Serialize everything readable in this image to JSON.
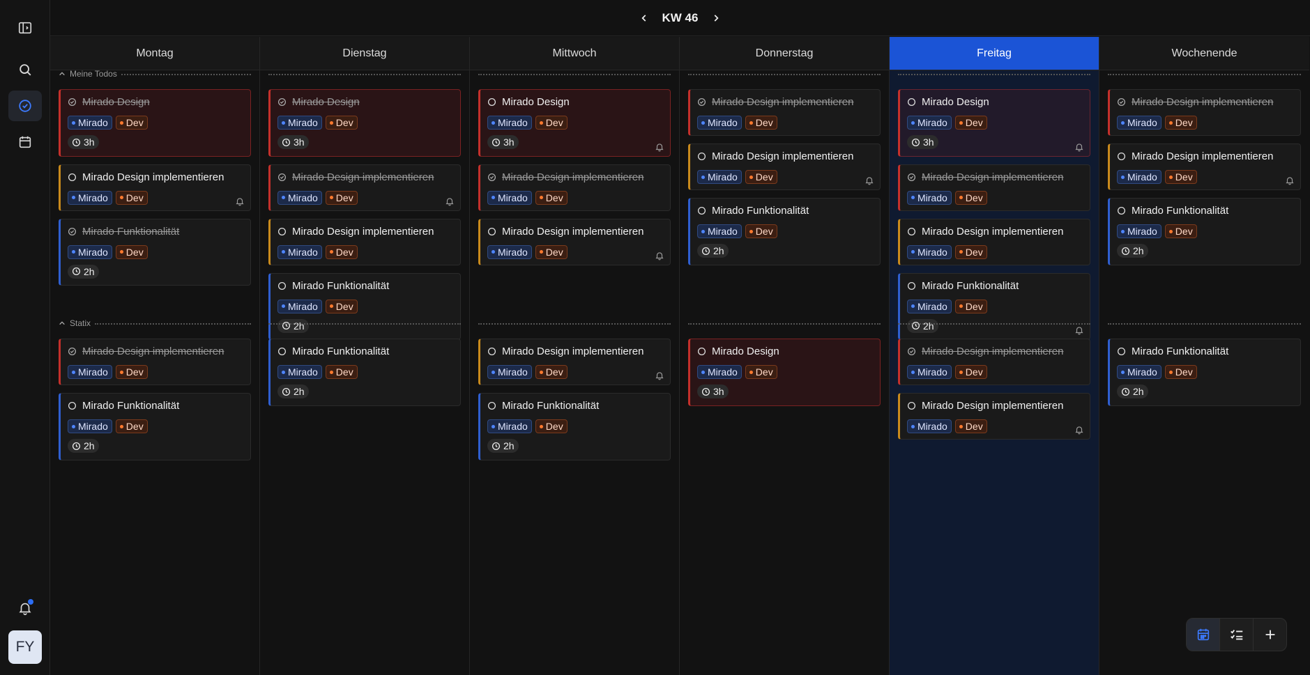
{
  "header": {
    "week_label": "KW 46"
  },
  "sidebar": {
    "avatar_initials": "FY"
  },
  "sections": [
    "Meine Todos",
    "Statix"
  ],
  "days": [
    {
      "label": "Montag",
      "today": false,
      "groups": [
        [
          {
            "title": "Mirado Design",
            "done": true,
            "style": "hl",
            "duration": "3h",
            "bell": false
          },
          {
            "title": "Mirado Design implementieren",
            "done": false,
            "style": "c-amber",
            "duration": null,
            "bell": true
          },
          {
            "title": "Mirado Funktionalität",
            "done": true,
            "style": "c-blue",
            "duration": "2h",
            "bell": false
          }
        ],
        [
          {
            "title": "Mirado Design implementieren",
            "done": true,
            "style": "c-red",
            "duration": null,
            "bell": false
          },
          {
            "title": "Mirado Funktionalität",
            "done": false,
            "style": "c-blue",
            "duration": "2h",
            "bell": false
          }
        ]
      ]
    },
    {
      "label": "Dienstag",
      "today": false,
      "groups": [
        [
          {
            "title": "Mirado Design",
            "done": true,
            "style": "hl",
            "duration": "3h",
            "bell": false
          },
          {
            "title": "Mirado Design implementieren",
            "done": true,
            "style": "c-red",
            "duration": null,
            "bell": true
          },
          {
            "title": "Mirado Design implementieren",
            "done": false,
            "style": "c-amber",
            "duration": null,
            "bell": false
          },
          {
            "title": "Mirado Funktionalität",
            "done": false,
            "style": "c-blue",
            "duration": "2h",
            "bell": false
          }
        ],
        [
          {
            "title": "Mirado Funktionalität",
            "done": false,
            "style": "c-blue",
            "duration": "2h",
            "bell": false
          }
        ]
      ]
    },
    {
      "label": "Mittwoch",
      "today": false,
      "groups": [
        [
          {
            "title": "Mirado Design",
            "done": false,
            "style": "hl",
            "duration": "3h",
            "bell": true
          },
          {
            "title": "Mirado Design implementieren",
            "done": true,
            "style": "c-red",
            "duration": null,
            "bell": false
          },
          {
            "title": "Mirado Design implementieren",
            "done": false,
            "style": "c-amber",
            "duration": null,
            "bell": true
          }
        ],
        [
          {
            "title": "Mirado Design implementieren",
            "done": false,
            "style": "c-amber",
            "duration": null,
            "bell": true
          },
          {
            "title": "Mirado Funktionalität",
            "done": false,
            "style": "c-blue",
            "duration": "2h",
            "bell": false
          }
        ]
      ]
    },
    {
      "label": "Donnerstag",
      "today": false,
      "groups": [
        [
          {
            "title": "Mirado Design implementieren",
            "done": true,
            "style": "c-red",
            "duration": null,
            "bell": false
          },
          {
            "title": "Mirado Design implementieren",
            "done": false,
            "style": "c-amber",
            "duration": null,
            "bell": true
          },
          {
            "title": "Mirado Funktionalität",
            "done": false,
            "style": "c-blue",
            "duration": "2h",
            "bell": false
          }
        ],
        [
          {
            "title": "Mirado Design",
            "done": false,
            "style": "hl",
            "duration": "3h",
            "bell": false
          }
        ]
      ]
    },
    {
      "label": "Freitag",
      "today": true,
      "groups": [
        [
          {
            "title": "Mirado Design",
            "done": false,
            "style": "hl-blue",
            "duration": "3h",
            "bell": true
          },
          {
            "title": "Mirado Design implementieren",
            "done": true,
            "style": "c-red",
            "duration": null,
            "bell": false
          },
          {
            "title": "Mirado Design implementieren",
            "done": false,
            "style": "c-amber",
            "duration": null,
            "bell": false
          },
          {
            "title": "Mirado Funktionalität",
            "done": false,
            "style": "c-blue",
            "duration": "2h",
            "bell": true
          }
        ],
        [
          {
            "title": "Mirado Design implementieren",
            "done": true,
            "style": "c-red",
            "duration": null,
            "bell": false
          },
          {
            "title": "Mirado Design implementieren",
            "done": false,
            "style": "c-amber",
            "duration": null,
            "bell": true
          }
        ]
      ]
    },
    {
      "label": "Wochenende",
      "today": false,
      "groups": [
        [
          {
            "title": "Mirado Design implementieren",
            "done": true,
            "style": "c-red",
            "duration": null,
            "bell": false
          },
          {
            "title": "Mirado Design implementieren",
            "done": false,
            "style": "c-amber",
            "duration": null,
            "bell": true
          },
          {
            "title": "Mirado Funktionalität",
            "done": false,
            "style": "c-blue",
            "duration": "2h",
            "bell": false
          }
        ],
        [
          {
            "title": "Mirado Funktionalität",
            "done": false,
            "style": "c-blue",
            "duration": "2h",
            "bell": false
          }
        ]
      ]
    }
  ],
  "tags": {
    "project": "Mirado",
    "type": "Dev"
  },
  "icons": {
    "sidebar": [
      "sidebar-toggle-icon",
      "search-icon",
      "todo-check-icon",
      "calendar-icon",
      "bell-icon"
    ],
    "toolbar": [
      "calendar-view-icon",
      "list-check-icon",
      "plus-icon"
    ]
  },
  "colors": {
    "accent": "#1b54d6",
    "red": "#c4302b",
    "amber": "#c98a1c",
    "blue": "#2f5fd0"
  }
}
